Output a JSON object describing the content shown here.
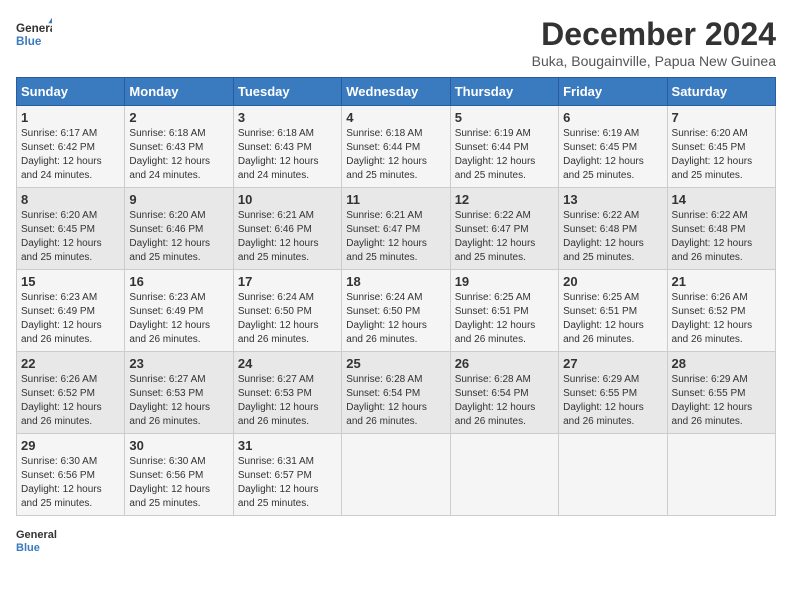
{
  "header": {
    "logo_line1": "General",
    "logo_line2": "Blue",
    "title": "December 2024",
    "subtitle": "Buka, Bougainville, Papua New Guinea"
  },
  "days_of_week": [
    "Sunday",
    "Monday",
    "Tuesday",
    "Wednesday",
    "Thursday",
    "Friday",
    "Saturday"
  ],
  "weeks": [
    [
      {
        "day": "1",
        "sunrise": "6:17 AM",
        "sunset": "6:42 PM",
        "daylight": "12 hours and 24 minutes."
      },
      {
        "day": "2",
        "sunrise": "6:18 AM",
        "sunset": "6:43 PM",
        "daylight": "12 hours and 24 minutes."
      },
      {
        "day": "3",
        "sunrise": "6:18 AM",
        "sunset": "6:43 PM",
        "daylight": "12 hours and 24 minutes."
      },
      {
        "day": "4",
        "sunrise": "6:18 AM",
        "sunset": "6:44 PM",
        "daylight": "12 hours and 25 minutes."
      },
      {
        "day": "5",
        "sunrise": "6:19 AM",
        "sunset": "6:44 PM",
        "daylight": "12 hours and 25 minutes."
      },
      {
        "day": "6",
        "sunrise": "6:19 AM",
        "sunset": "6:45 PM",
        "daylight": "12 hours and 25 minutes."
      },
      {
        "day": "7",
        "sunrise": "6:20 AM",
        "sunset": "6:45 PM",
        "daylight": "12 hours and 25 minutes."
      }
    ],
    [
      {
        "day": "8",
        "sunrise": "6:20 AM",
        "sunset": "6:45 PM",
        "daylight": "12 hours and 25 minutes."
      },
      {
        "day": "9",
        "sunrise": "6:20 AM",
        "sunset": "6:46 PM",
        "daylight": "12 hours and 25 minutes."
      },
      {
        "day": "10",
        "sunrise": "6:21 AM",
        "sunset": "6:46 PM",
        "daylight": "12 hours and 25 minutes."
      },
      {
        "day": "11",
        "sunrise": "6:21 AM",
        "sunset": "6:47 PM",
        "daylight": "12 hours and 25 minutes."
      },
      {
        "day": "12",
        "sunrise": "6:22 AM",
        "sunset": "6:47 PM",
        "daylight": "12 hours and 25 minutes."
      },
      {
        "day": "13",
        "sunrise": "6:22 AM",
        "sunset": "6:48 PM",
        "daylight": "12 hours and 25 minutes."
      },
      {
        "day": "14",
        "sunrise": "6:22 AM",
        "sunset": "6:48 PM",
        "daylight": "12 hours and 26 minutes."
      }
    ],
    [
      {
        "day": "15",
        "sunrise": "6:23 AM",
        "sunset": "6:49 PM",
        "daylight": "12 hours and 26 minutes."
      },
      {
        "day": "16",
        "sunrise": "6:23 AM",
        "sunset": "6:49 PM",
        "daylight": "12 hours and 26 minutes."
      },
      {
        "day": "17",
        "sunrise": "6:24 AM",
        "sunset": "6:50 PM",
        "daylight": "12 hours and 26 minutes."
      },
      {
        "day": "18",
        "sunrise": "6:24 AM",
        "sunset": "6:50 PM",
        "daylight": "12 hours and 26 minutes."
      },
      {
        "day": "19",
        "sunrise": "6:25 AM",
        "sunset": "6:51 PM",
        "daylight": "12 hours and 26 minutes."
      },
      {
        "day": "20",
        "sunrise": "6:25 AM",
        "sunset": "6:51 PM",
        "daylight": "12 hours and 26 minutes."
      },
      {
        "day": "21",
        "sunrise": "6:26 AM",
        "sunset": "6:52 PM",
        "daylight": "12 hours and 26 minutes."
      }
    ],
    [
      {
        "day": "22",
        "sunrise": "6:26 AM",
        "sunset": "6:52 PM",
        "daylight": "12 hours and 26 minutes."
      },
      {
        "day": "23",
        "sunrise": "6:27 AM",
        "sunset": "6:53 PM",
        "daylight": "12 hours and 26 minutes."
      },
      {
        "day": "24",
        "sunrise": "6:27 AM",
        "sunset": "6:53 PM",
        "daylight": "12 hours and 26 minutes."
      },
      {
        "day": "25",
        "sunrise": "6:28 AM",
        "sunset": "6:54 PM",
        "daylight": "12 hours and 26 minutes."
      },
      {
        "day": "26",
        "sunrise": "6:28 AM",
        "sunset": "6:54 PM",
        "daylight": "12 hours and 26 minutes."
      },
      {
        "day": "27",
        "sunrise": "6:29 AM",
        "sunset": "6:55 PM",
        "daylight": "12 hours and 26 minutes."
      },
      {
        "day": "28",
        "sunrise": "6:29 AM",
        "sunset": "6:55 PM",
        "daylight": "12 hours and 26 minutes."
      }
    ],
    [
      {
        "day": "29",
        "sunrise": "6:30 AM",
        "sunset": "6:56 PM",
        "daylight": "12 hours and 25 minutes."
      },
      {
        "day": "30",
        "sunrise": "6:30 AM",
        "sunset": "6:56 PM",
        "daylight": "12 hours and 25 minutes."
      },
      {
        "day": "31",
        "sunrise": "6:31 AM",
        "sunset": "6:57 PM",
        "daylight": "12 hours and 25 minutes."
      },
      null,
      null,
      null,
      null
    ]
  ],
  "labels": {
    "sunrise": "Sunrise:",
    "sunset": "Sunset:",
    "daylight": "Daylight:"
  }
}
